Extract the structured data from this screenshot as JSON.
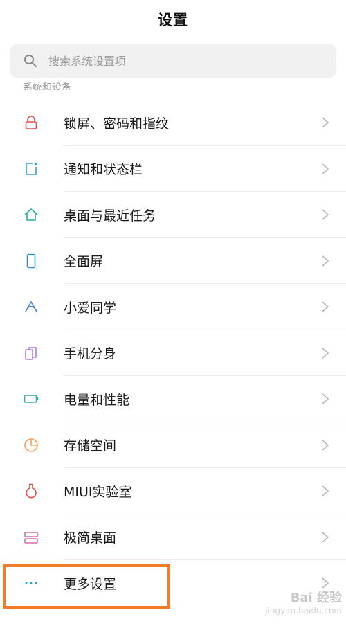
{
  "header": {
    "title": "设置"
  },
  "search": {
    "placeholder": "搜索系统设置项"
  },
  "section_title": "系统和设备",
  "settings": [
    {
      "label": "锁屏、密码和指纹",
      "icon": "lock-icon",
      "color": "#e24d4d"
    },
    {
      "label": "通知和状态栏",
      "icon": "notification-icon",
      "color": "#2fa3c8"
    },
    {
      "label": "桌面与最近任务",
      "icon": "home-icon",
      "color": "#2bb0a5"
    },
    {
      "label": "全面屏",
      "icon": "phone-icon",
      "color": "#2d8fd8"
    },
    {
      "label": "小爱同学",
      "icon": "xiaoai-icon",
      "color": "#4a7ad8"
    },
    {
      "label": "手机分身",
      "icon": "dual-phone-icon",
      "color": "#b07ad8"
    },
    {
      "label": "电量和性能",
      "icon": "battery-icon",
      "color": "#2bb0a5"
    },
    {
      "label": "存储空间",
      "icon": "storage-pie-icon",
      "color": "#f0a25a"
    },
    {
      "label": "MIUI实验室",
      "icon": "flask-icon",
      "color": "#e24d4d"
    },
    {
      "label": "极简桌面",
      "icon": "minimal-home-icon",
      "color": "#d86ab0"
    },
    {
      "label": "更多设置",
      "icon": "more-dots-icon",
      "color": "#2fa3c8"
    }
  ],
  "highlight_color": "#f37c2b",
  "watermark": {
    "brand": "Bai 经验",
    "site": "jingyan.baidu.com"
  }
}
